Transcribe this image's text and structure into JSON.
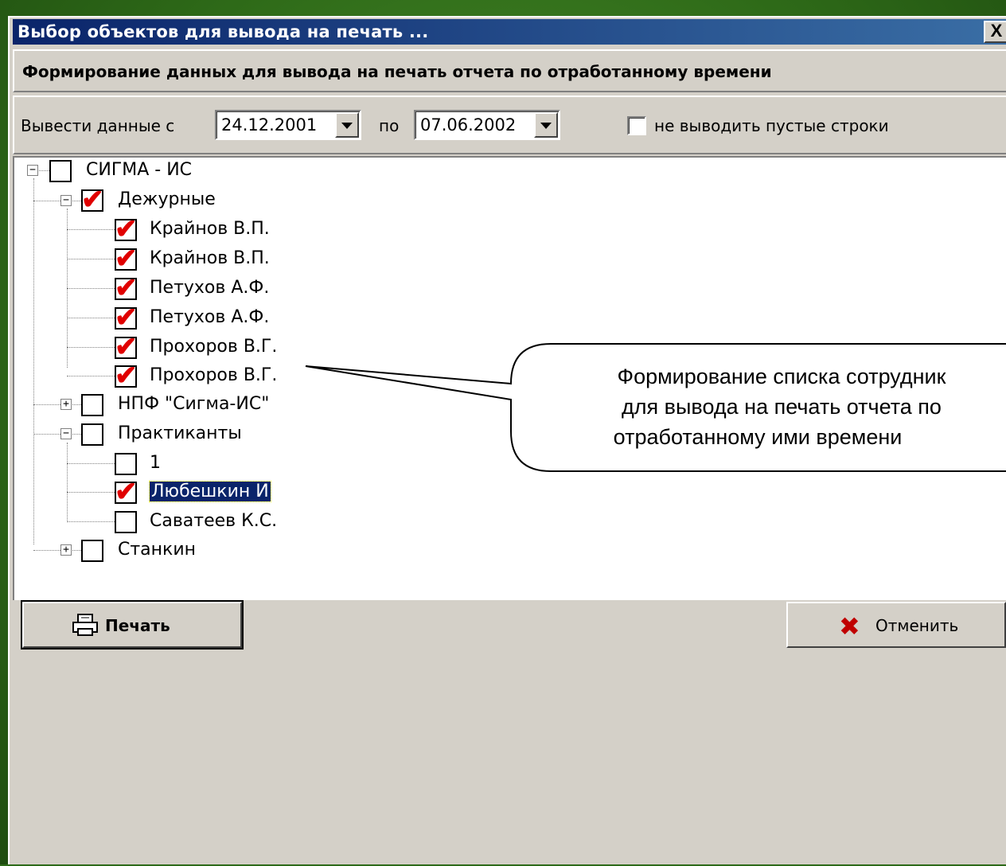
{
  "window": {
    "title": "Выбор объектов для вывода на печать ...",
    "close_label": "X"
  },
  "header": {
    "text": "Формирование данных для вывода на печать отчета по отработанному времени"
  },
  "filter": {
    "from_label": "Вывести данные с",
    "from_value": "24.12.2001",
    "to_label": "по",
    "to_value": "07.06.2002",
    "skip_empty_label": "не выводить пустые строки",
    "skip_empty_checked": false
  },
  "tree": {
    "root": "СИГМА - ИС",
    "group_duty": "Дежурные",
    "duty": [
      "Крайнов В.П.",
      "Крайнов В.П.",
      "Петухов А.Ф.",
      "Петухов А.Ф.",
      "Прохоров В.Г.",
      "Прохоров В.Г."
    ],
    "group_npf": "НПФ \"Сигма-ИС\"",
    "group_trainees": "Практиканты",
    "trainees": [
      "1",
      "Любешкин И",
      "Саватеев К.С."
    ],
    "group_stankin": "Станкин"
  },
  "callout": {
    "line1": "Формирование списка сотрудник",
    "line2": "для вывода на печать отчета по",
    "line3": "отработанному ими времени"
  },
  "buttons": {
    "print_label": "Печать",
    "cancel_label": "Отменить"
  },
  "colors": {
    "check": "#e00000",
    "title_bar": "#0a246a",
    "background": "#2e6b1a"
  }
}
